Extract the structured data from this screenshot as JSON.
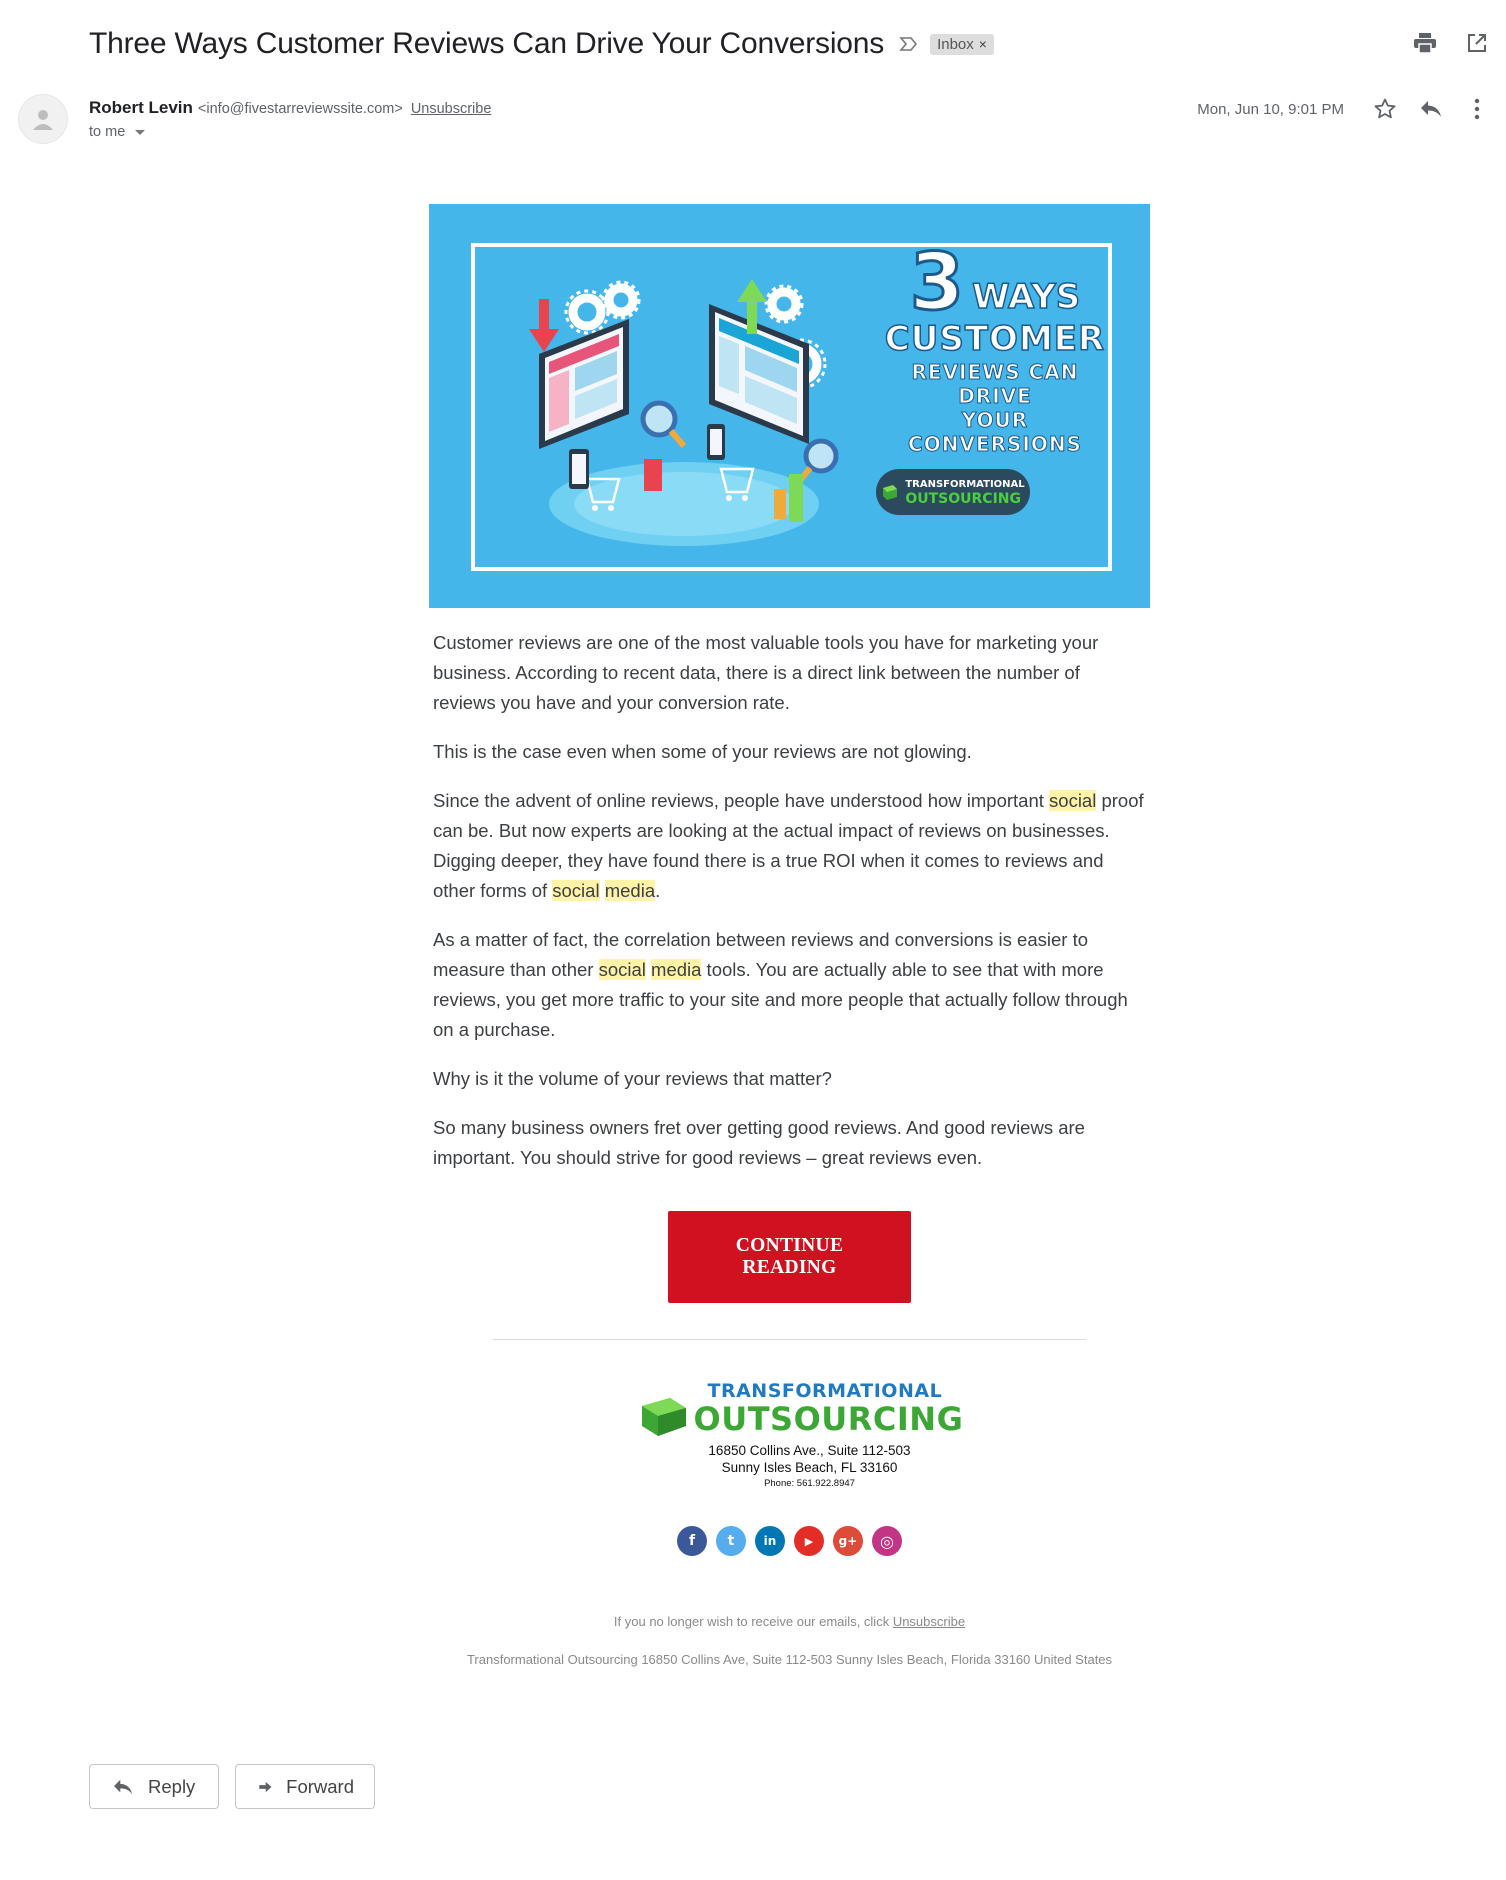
{
  "email": {
    "subject": "Three Ways Customer Reviews Can Drive Your Conversions",
    "label": "Inbox",
    "label_close": "×",
    "sender_name": "Robert Levin",
    "sender_email": "<info@fivestarreviewssite.com>",
    "unsubscribe_label": "Unsubscribe",
    "to_label": "to me",
    "date": "Mon, Jun 10, 9:01 PM"
  },
  "icons": {
    "importance": "label-arrow-icon",
    "print": "print-icon",
    "new_window": "open-in-new-icon",
    "avatar": "person-icon",
    "star": "star-icon",
    "reply": "reply-icon",
    "more": "more-vert-icon"
  },
  "hero": {
    "number": "3",
    "ways": "WAYS",
    "customer": "CUSTOMER",
    "line3": "REVIEWS CAN DRIVE",
    "line4": "YOUR CONVERSIONS",
    "badge_line1": "TRANSFORMATIONAL",
    "badge_line2": "OUTSOURCING",
    "background_color": "#44b6ea"
  },
  "body": {
    "p1": "Customer reviews are one of the most valuable tools you have for marketing your business. According to recent data, there is a direct link between the number of reviews you have and your conversion rate.",
    "p2": "This is the case even when some of your reviews are not glowing.",
    "p3_a": "Since the advent of online reviews, people have understood how important ",
    "p3_hl1": "social",
    "p3_b": " proof can be. But now experts are looking at the actual impact of reviews on businesses. Digging deeper, they have found there is a true ROI when it comes to reviews and other forms of ",
    "p3_hl2": "social",
    "p3_sp": " ",
    "p3_hl3": "media",
    "p3_c": ".",
    "p4_a": "As a matter of fact, the correlation between reviews and conversions is easier to measure than other ",
    "p4_hl1": "social",
    "p4_sp": " ",
    "p4_hl2": "media",
    "p4_b": " tools. You are actually able to see that with more reviews, you get more traffic to your site and more people that actually follow through on a purchase.",
    "p5": "Why is it the volume of your reviews that matter?",
    "p6": "So many business owners fret over getting good reviews. And good reviews are important. You should strive for good reviews – great reviews even.",
    "cta": "CONTINUE READING",
    "cta_color": "#cf1120"
  },
  "footer": {
    "logo_line1": "TRANSFORMATIONAL",
    "logo_line2": "OUTSOURCING",
    "address1": "16850 Collins Ave., Suite 112-503",
    "address2": "Sunny Isles Beach, FL 33160",
    "phone": "Phone: 561.922.8947",
    "social": [
      {
        "name": "facebook-icon",
        "glyph": "f",
        "color": "#3b5998"
      },
      {
        "name": "twitter-icon",
        "glyph": "t",
        "color": "#55acee"
      },
      {
        "name": "linkedin-icon",
        "glyph": "in",
        "color": "#0077b5"
      },
      {
        "name": "youtube-icon",
        "glyph": "▶",
        "color": "#e52d27"
      },
      {
        "name": "google-plus-icon",
        "glyph": "g+",
        "color": "#dd4b39"
      },
      {
        "name": "instagram-icon",
        "glyph": "◎",
        "color": "#c13584"
      }
    ],
    "unsub_text": "If you no longer wish to receive our emails, click ",
    "unsub_link": "Unsubscribe",
    "postal": "Transformational Outsourcing 16850 Collins Ave, Suite 112-503 Sunny Isles Beach, Florida 33160 United States"
  },
  "actions": {
    "reply": "Reply",
    "forward": "Forward"
  }
}
